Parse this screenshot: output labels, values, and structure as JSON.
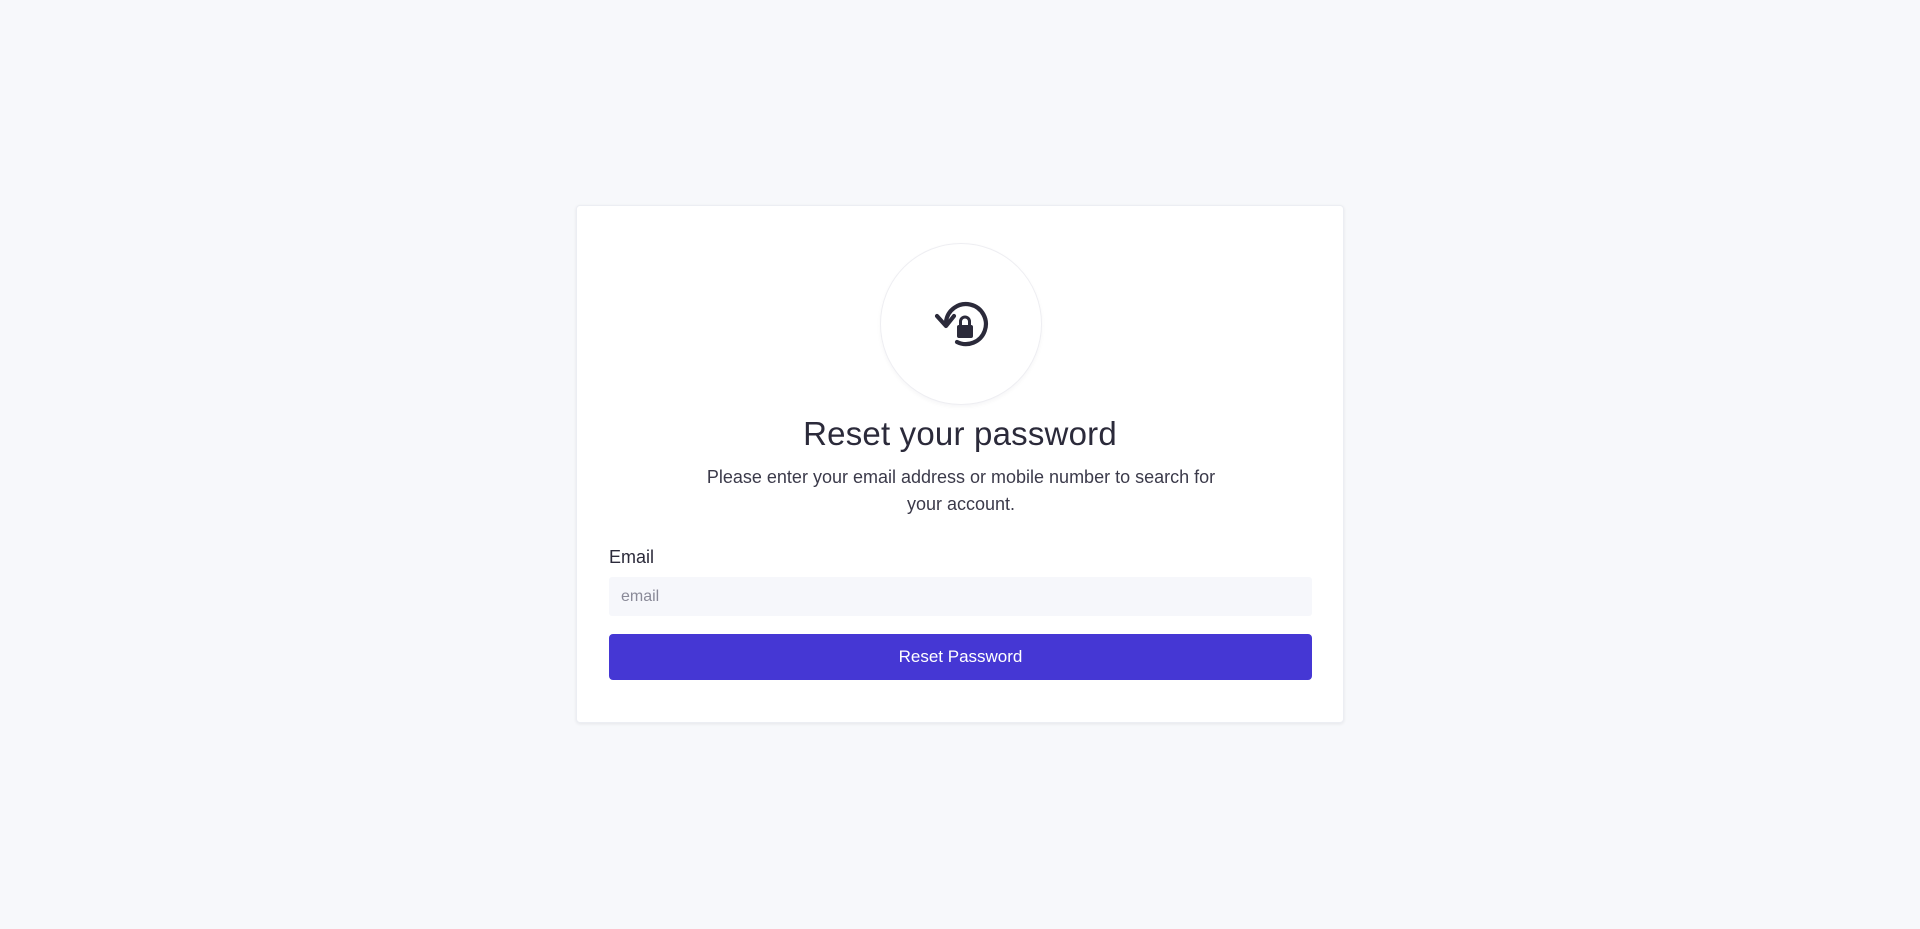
{
  "colors": {
    "background": "#f7f8fb",
    "card": "#ffffff",
    "primary_button": "#4537d4",
    "text": "#2b2a3a",
    "input_background": "#f6f7fb"
  },
  "header": {
    "icon": "lock-reset-icon",
    "title": "Reset your password",
    "subtitle": "Please enter your email address or mobile number to search for your account."
  },
  "form": {
    "email": {
      "label": "Email",
      "value": "",
      "placeholder": "email"
    },
    "submit_label": "Reset Password"
  }
}
